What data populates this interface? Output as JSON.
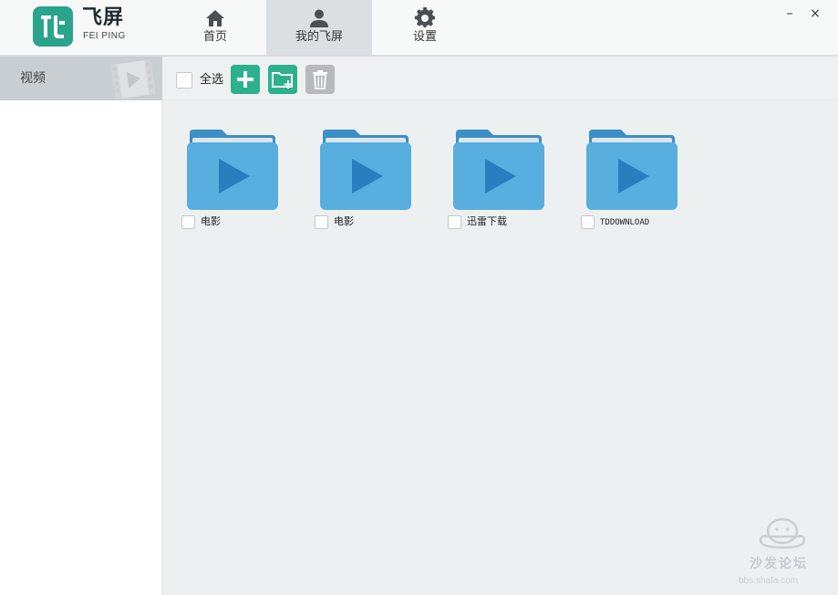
{
  "app": {
    "name_cn": "飞屏",
    "name_en": "FEI PING"
  },
  "nav": {
    "tabs": [
      {
        "label": "首页",
        "icon": "home-icon",
        "active": false
      },
      {
        "label": "我的飞屏",
        "icon": "user-icon",
        "active": true
      },
      {
        "label": "设置",
        "icon": "gear-icon",
        "active": false
      }
    ]
  },
  "window": {
    "minimize_glyph": "–",
    "close_glyph": "×"
  },
  "sidebar": {
    "items": [
      {
        "label": "视频",
        "icon": "film-icon",
        "selected": true
      }
    ]
  },
  "toolbar": {
    "select_all_label": "全选",
    "buttons": [
      {
        "icon": "plus-icon"
      },
      {
        "icon": "new-folder-icon"
      },
      {
        "icon": "trash-icon"
      }
    ]
  },
  "folders": [
    {
      "name": "电影",
      "icon": "video-folder-icon"
    },
    {
      "name": "电影",
      "icon": "video-folder-icon"
    },
    {
      "name": "迅雷下载",
      "icon": "video-folder-icon"
    },
    {
      "name": "TDDOWNLOAD",
      "icon": "video-folder-icon"
    }
  ],
  "watermark": {
    "text": "沙发论坛",
    "url": "bbs.shafa.com"
  },
  "colors": {
    "brand_green": "#2aa48a",
    "folder_blue": "#58aede",
    "play_blue": "#2a7ebf"
  }
}
